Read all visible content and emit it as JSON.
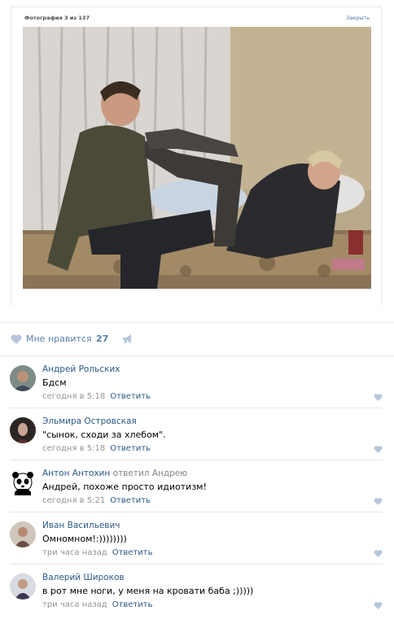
{
  "photo_viewer": {
    "title": "Фотография 3 из 137",
    "close_label": "Закрыть"
  },
  "likes": {
    "label": "Мне нравится",
    "count": "27"
  },
  "comments": [
    {
      "author": "Андрей Рольских",
      "text": "Бдсм",
      "time": "сегодня в 5:18",
      "reply": "Ответить",
      "avatar": "avatar-1"
    },
    {
      "author": "Эльмира Островская",
      "text": "\"сынок, сходи за хлебом\".",
      "time": "сегодня в 5:18",
      "reply": "Ответить",
      "avatar": "avatar-2"
    },
    {
      "author": "Антон Антохин",
      "reply_to": "ответил Андрею",
      "text": "Андрей, похоже просто идиотизм!",
      "time": "сегодня в 5:21",
      "reply": "Ответить",
      "avatar": "panda-avatar"
    },
    {
      "author": "Иван Васильевич",
      "text": "Омномном!:))))))))",
      "time": "три часа назад",
      "reply": "Ответить",
      "avatar": "avatar-4"
    },
    {
      "author": "Валерий Широков",
      "text": "в рот мне ноги, у меня на кровати баба ;)))))",
      "time": "три часа назад",
      "reply": "Ответить",
      "avatar": "avatar-5"
    }
  ],
  "colors": {
    "link": "#2a5885",
    "meta": "#939393",
    "like_icon": "#b5c7d9",
    "divider": "#e7e8ec"
  }
}
